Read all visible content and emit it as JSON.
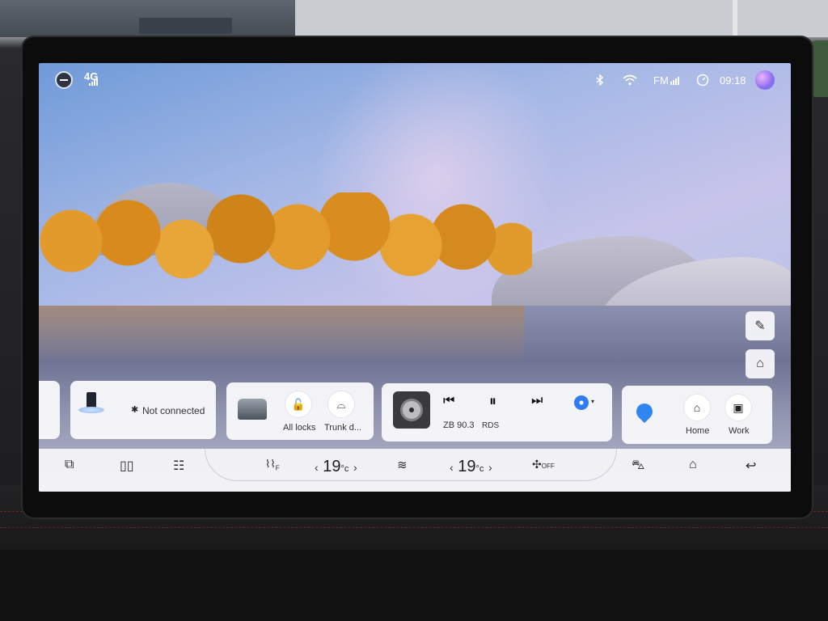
{
  "status_bar": {
    "network": "4G",
    "radio": "FM",
    "time": "09:18",
    "icons": [
      "minimize-icon",
      "signal-icon",
      "bluetooth-icon",
      "wifi-icon",
      "radio-signal-icon",
      "gauge-icon",
      "assistant-icon"
    ]
  },
  "side_buttons": [
    "paint-icon",
    "home-swap-icon"
  ],
  "cards": {
    "phone": {
      "status": "Not connected"
    },
    "car": {
      "locks_label": "All locks",
      "trunk_label": "Trunk d..."
    },
    "media": {
      "station": "ZB 90.3",
      "rds": "RDS"
    },
    "nav": {
      "home_label": "Home",
      "work_label": "Work"
    }
  },
  "dock": {
    "left_temp": "19",
    "right_temp": "19",
    "unit": "°c",
    "fan": "OFF",
    "defrost_sub": "F"
  }
}
